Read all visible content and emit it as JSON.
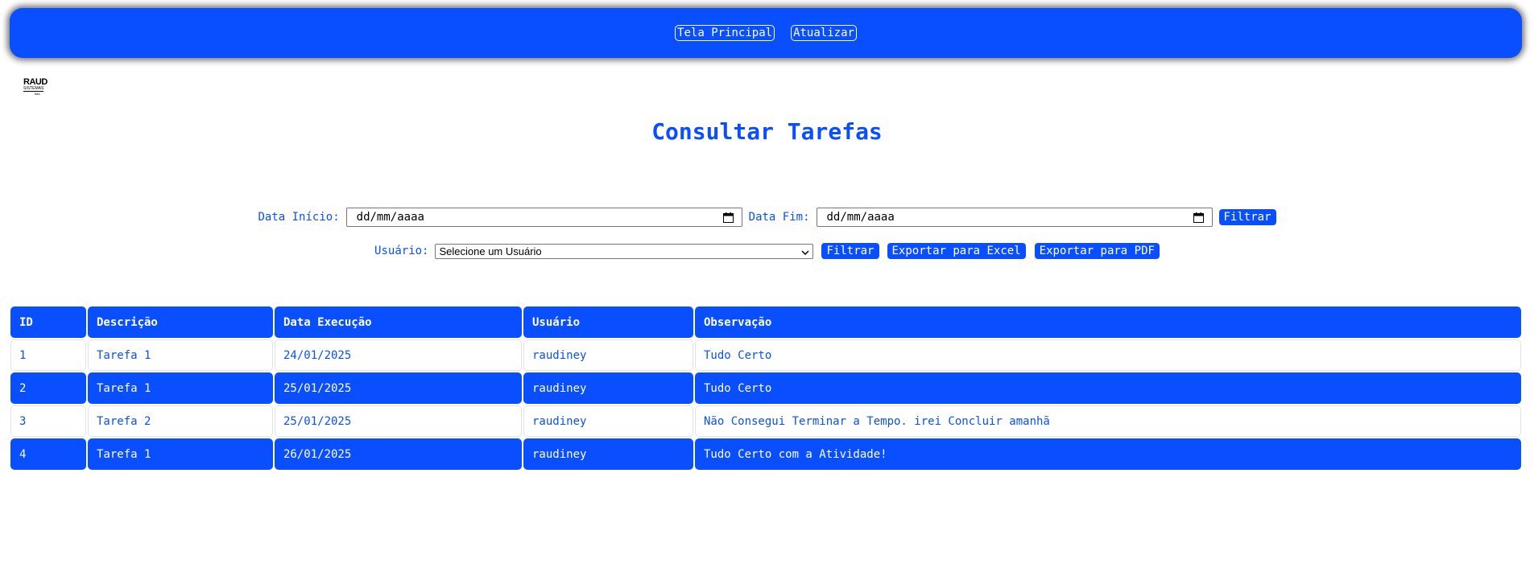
{
  "topbar": {
    "home_label": "Tela Principal",
    "refresh_label": "Atualizar"
  },
  "logo": {
    "main": "RAUD",
    "sub": "SISTEMAS",
    "tiny": "ltda"
  },
  "page": {
    "title": "Consultar Tarefas"
  },
  "filters": {
    "start_label": "Data Início:",
    "start_value": "dd/mm/aaaa",
    "end_label": "Data Fim:",
    "end_value": "dd/mm/aaaa",
    "filter_date_label": "Filtrar",
    "user_label": "Usuário:",
    "user_selected": "Selecione um Usuário",
    "filter_user_label": "Filtrar",
    "export_excel_label": "Exportar para Excel",
    "export_pdf_label": "Exportar para PDF"
  },
  "table": {
    "headers": [
      "ID",
      "Descrição",
      "Data Execução",
      "Usuário",
      "Observação"
    ],
    "rows": [
      [
        "1",
        "Tarefa 1",
        "24/01/2025",
        "raudiney",
        "Tudo Certo"
      ],
      [
        "2",
        "Tarefa 1",
        "25/01/2025",
        "raudiney",
        "Tudo Certo"
      ],
      [
        "3",
        "Tarefa 2",
        "25/01/2025",
        "raudiney",
        "Não Consegui Terminar a Tempo. irei Concluir amanhã"
      ],
      [
        "4",
        "Tarefa 1",
        "26/01/2025",
        "raudiney",
        "Tudo Certo com a Atividade!"
      ]
    ]
  },
  "colors": {
    "accent": "#0a4fff",
    "background": "#ffffff"
  },
  "icons": {
    "date_picker": "calendar-icon",
    "select": "chevron-down-icon"
  }
}
